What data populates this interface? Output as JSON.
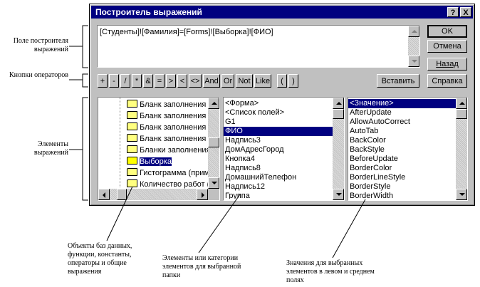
{
  "dialog": {
    "title": "Построитель выражений",
    "help_btn": "?",
    "close_btn": "X",
    "expression": "[Студенты]![Фамилия]=[Forms]![Выборка]![ФИО]",
    "buttons": {
      "ok": "OK",
      "cancel": "Отмена",
      "back": "Назад",
      "paste": "Вставить",
      "help": "Справка"
    },
    "operators": [
      "+",
      "-",
      "/",
      "*",
      "&",
      "=",
      ">",
      "<",
      "<>",
      "And",
      "Or",
      "Not",
      "Like",
      "(",
      ")"
    ]
  },
  "left_list": [
    {
      "label": "Бланк заполнения т",
      "open": false
    },
    {
      "label": "Бланк заполнения т",
      "open": false
    },
    {
      "label": "Бланк заполнения т",
      "open": false
    },
    {
      "label": "Бланк заполнения т",
      "open": false
    },
    {
      "label": "Бланки заполнения",
      "open": false
    },
    {
      "label": "Выборка",
      "open": true,
      "selected": true
    },
    {
      "label": "Гистограмма (прим",
      "open": false
    },
    {
      "label": "Количество работ (",
      "open": false
    }
  ],
  "middle_list": [
    "<Форма>",
    "<Список полей>",
    "G1",
    "ФИО",
    "Надпись3",
    "ДомАдресГород",
    "Кнопка4",
    "Надпись8",
    "ДомашнийТелефон",
    "Надпись12",
    "Группа"
  ],
  "middle_selected": 3,
  "right_list": [
    "<Значение>",
    "AfterUpdate",
    "AllowAutoCorrect",
    "AutoTab",
    "BackColor",
    "BackStyle",
    "BeforeUpdate",
    "BorderColor",
    "BorderLineStyle",
    "BorderStyle",
    "BorderWidth"
  ],
  "right_selected": 0,
  "annotations": {
    "field": "Поле построителя выражений",
    "operators": "Кнопки операторов",
    "elements": "Элементы выражений",
    "objects": "Объекты баз данных, функции, константы, операторы и общие выражения",
    "categories": "Элементы или категории элементов для выбранной папки",
    "values": "Значения для выбранных элементов в левом и среднем полях"
  }
}
